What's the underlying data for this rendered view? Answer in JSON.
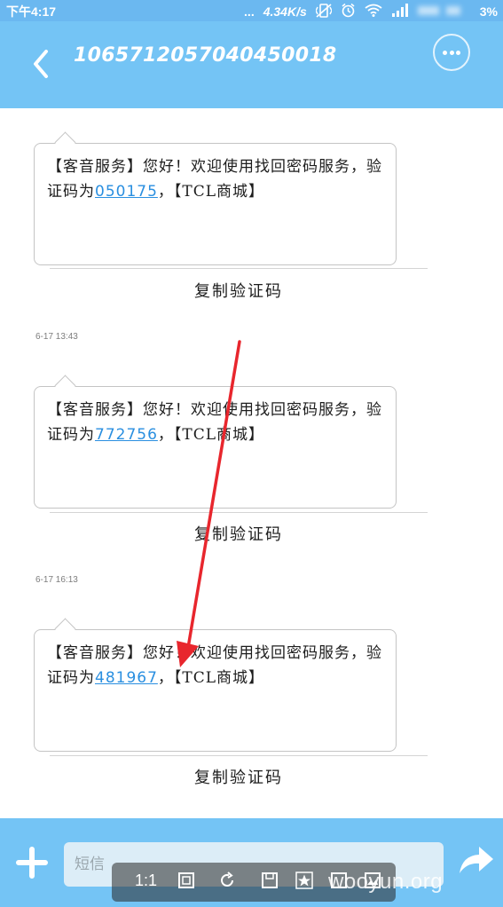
{
  "status_bar": {
    "time": "下午4:17",
    "dots": "...",
    "network_speed": "4.34K/s",
    "battery": "3%"
  },
  "header": {
    "contact": "1065712057040450018"
  },
  "messages": [
    {
      "timestamp": "",
      "text_before": "【客音服务】您好！欢迎使用找回密码服务，验证码为",
      "code": "050175",
      "text_after": "，【TCL商城】",
      "copy_label": "复制验证码"
    },
    {
      "timestamp": "6-17 13:43",
      "text_before": "【客音服务】您好！欢迎使用找回密码服务，验证码为",
      "code": "772756",
      "text_after": "，【TCL商城】",
      "copy_label": "复制验证码"
    },
    {
      "timestamp": "6-17 16:13",
      "text_before": "【客音服务】您好！欢迎使用找回密码服务，验证码为",
      "code": "481967",
      "text_after": "，【TCL商城】",
      "copy_label": "复制验证码"
    }
  ],
  "compose": {
    "placeholder": "短信"
  },
  "viewer_toolbar": {
    "zoom_label": "1:1"
  },
  "watermark": "wooyun.org",
  "colors": {
    "header_bg": "#74c4f5",
    "status_bg": "#6bb8f0",
    "link": "#2a8fe0",
    "annotation": "#e8262d"
  }
}
